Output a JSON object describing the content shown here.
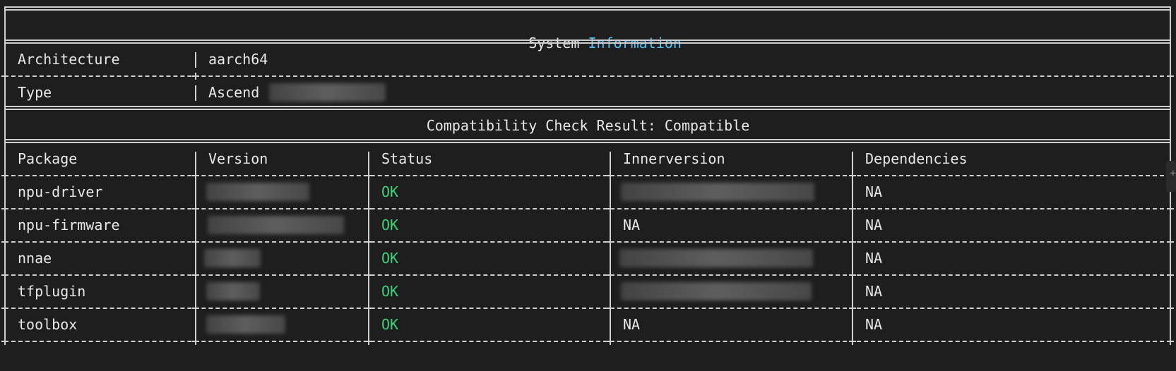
{
  "title": {
    "part1": "System ",
    "part2": "Information"
  },
  "system": {
    "rows": [
      {
        "label": "Architecture",
        "value": "aarch64"
      },
      {
        "label": "Type",
        "value": "Ascend"
      }
    ]
  },
  "compat_result": "Compatibility Check Result: Compatible",
  "table": {
    "headers": [
      "Package",
      "Version",
      "Status",
      "Innerversion",
      "Dependencies"
    ],
    "rows": [
      {
        "package": "npu-driver",
        "status": "OK",
        "innerversion": "",
        "dependencies": "NA"
      },
      {
        "package": "npu-firmware",
        "status": "OK",
        "innerversion": "NA",
        "dependencies": "NA"
      },
      {
        "package": "nnae",
        "status": "OK",
        "innerversion": "",
        "dependencies": "NA"
      },
      {
        "package": "tfplugin",
        "status": "OK",
        "innerversion": "",
        "dependencies": "NA"
      },
      {
        "package": "toolbox",
        "status": "OK",
        "innerversion": "NA",
        "dependencies": "NA"
      }
    ]
  },
  "colors": {
    "background": "#1e1e1e",
    "text": "#e8e8e8",
    "highlight": "#4fc3f7",
    "ok": "#3ad37a"
  }
}
